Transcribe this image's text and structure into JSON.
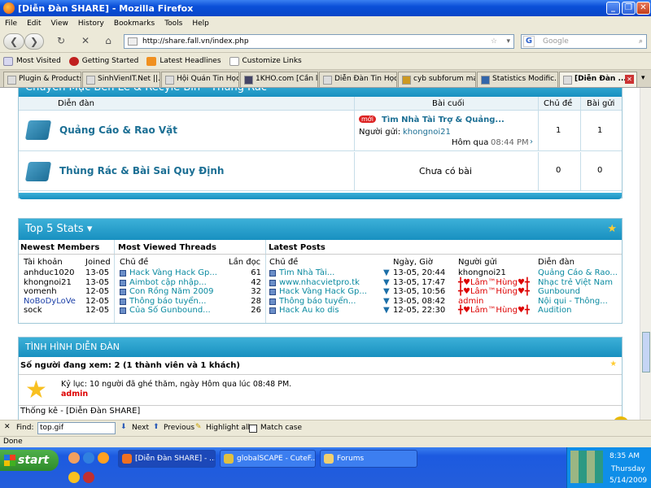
{
  "window": {
    "title": "[Diễn Đàn SHARE] - Mozilla Firefox"
  },
  "menu": [
    "File",
    "Edit",
    "View",
    "History",
    "Bookmarks",
    "Tools",
    "Help"
  ],
  "nav": {
    "url": "http://share.fall.vn/index.php",
    "search_placeholder": "Google"
  },
  "bookmarks": [
    "Most Visited",
    "Getting Started",
    "Latest Headlines",
    "Customize Links"
  ],
  "tabs": [
    "Plugin & Products...",
    "SinhVienIT.Net ||...",
    "Hội Quán Tin Học...",
    "1KHO.com [Cần l...",
    "Diễn Đàn Tin Học...",
    "cyb subforum ma...",
    "Statistics Modific...",
    "[Diễn Đàn ..."
  ],
  "forum": {
    "section_title": "Chuyên Mục Bên Lề & Recyle Bin - Thùng Rác",
    "headers": {
      "forum": "Diễn đàn",
      "last_post": "Bài cuối",
      "threads": "Chủ đề",
      "posts": "Bài gửi"
    },
    "rows": [
      {
        "name": "Quảng Cáo & Rao Vặt",
        "new_badge": "mới",
        "last_title": "Tìm Nhà Tài Trợ & Quảng...",
        "by_label": "Người gửi:",
        "by_user": "khongnoi21",
        "time_label": "Hôm qua",
        "time": "08:44 PM",
        "arrow": "›",
        "threads": "1",
        "posts": "1"
      },
      {
        "name": "Thùng Rác & Bài Sai Quy Định",
        "last_title": "Chưa có bài",
        "threads": "0",
        "posts": "0"
      }
    ]
  },
  "stats": {
    "title": "Top 5 Stats",
    "dropdown": "▾",
    "members": {
      "heading": "Newest Members",
      "col1": "Tài khoản",
      "col2": "Joined",
      "rows": [
        [
          "anhduc1020",
          "13-05"
        ],
        [
          "khongnoi21",
          "13-05"
        ],
        [
          "vomenh",
          "12-05"
        ],
        [
          "NoBoDyLoVe",
          "12-05"
        ],
        [
          "sock",
          "12-05"
        ]
      ]
    },
    "viewed": {
      "heading": "Most Viewed Threads",
      "col1": "Chủ đề",
      "col2": "Lần đọc",
      "rows": [
        [
          "Hack Vàng Hack Gp...",
          "61"
        ],
        [
          "Aimbot cập nhập...",
          "42"
        ],
        [
          "Con Rồng Năm 2009",
          "32"
        ],
        [
          "Thông báo tuyển...",
          "28"
        ],
        [
          "Của Số Gunbound...",
          "26"
        ]
      ]
    },
    "latest": {
      "heading": "Latest Posts",
      "col1": "Chủ đề",
      "col2": "Ngày, Giờ",
      "col3": "Người gửi",
      "col4": "Diễn đàn",
      "rows": [
        [
          "Tìm Nhà Tài...",
          "13-05, 20:44",
          "khongnoi21",
          "Quảng Cáo & Rao..."
        ],
        [
          "www.nhacvietpro.tk",
          "13-05, 17:47",
          "╋♥Lâm™Hùng♥╋",
          "Nhạc trẻ Việt Nam"
        ],
        [
          "Hack Vàng Hack Gp...",
          "13-05, 10:56",
          "╋♥Lâm™Hùng♥╋",
          "Gunbound"
        ],
        [
          "Thông báo tuyển...",
          "13-05, 08:42",
          "admin",
          "Nội qui - Thông..."
        ],
        [
          "Hack Au ko dis",
          "12-05, 22:30",
          "╋♥Lâm™Hùng♥╋",
          "Audition"
        ]
      ]
    }
  },
  "status": {
    "title": "TÌNH HÌNH DIỄN ĐÀN",
    "online": "Số người đang xem: 2 (1 thành viên và 1 khách)",
    "record": "Kỷ lục: 10 người đã ghé thăm, ngày Hôm qua lúc 08:48 PM.",
    "admin": "admin",
    "stats_cut": "Thống kê - [Diễn Đàn SHARE]"
  },
  "findbar": {
    "label": "Find:",
    "value": "top.gif",
    "next": "Next",
    "previous": "Previous",
    "highlight": "Highlight all",
    "match": "Match case"
  },
  "statusbar": "Done",
  "taskbar": {
    "start": "start",
    "items": [
      "[Diễn Đàn SHARE] - ...",
      "globalSCAPE - CuteF...",
      "Forums"
    ],
    "time": "8:35 AM",
    "day": "Thursday",
    "date": "5/14/2009"
  }
}
